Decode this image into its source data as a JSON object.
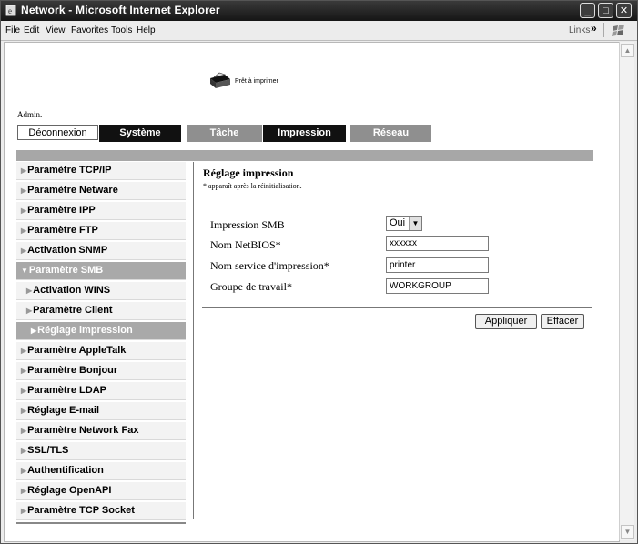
{
  "window": {
    "title": "Network - Microsoft Internet Explorer"
  },
  "menu": {
    "items": [
      "File",
      "Edit",
      "View",
      "Favorites",
      "Tools",
      "Help"
    ],
    "links_label": "Links",
    "chevron": "»"
  },
  "header": {
    "status_text": "Prêt à imprimer",
    "user_label": "Admin."
  },
  "top_nav": {
    "logout_label": "Déconnexion",
    "tabs": [
      "Système",
      "Tâche",
      "Impression",
      "Réseau"
    ],
    "active_tab": "Réseau"
  },
  "sidebar": {
    "items": [
      "Paramètre TCP/IP",
      "Paramètre Netware",
      "Paramètre IPP",
      "Paramètre FTP",
      "Activation SNMP",
      "Paramètre SMB",
      "Activation WINS",
      "Paramètre Client",
      "Réglage impression",
      "Paramètre AppleTalk",
      "Paramètre Bonjour",
      "Paramètre LDAP",
      "Réglage E-mail",
      "Paramètre Network Fax",
      "SSL/TLS",
      "Authentification",
      "Réglage OpenAPI",
      "Paramètre TCP Socket"
    ],
    "expanded": "Paramètre SMB",
    "selected": "Réglage impression"
  },
  "main": {
    "title": "Réglage impression",
    "note": "* apparaît après la réinitialisation.",
    "fields": {
      "smb_print": {
        "label": "Impression SMB",
        "value": "Oui"
      },
      "netbios_name": {
        "label": "Nom NetBIOS*",
        "value": "xxxxxx"
      },
      "print_service_name": {
        "label": "Nom service d'impression*",
        "value": "printer"
      },
      "workgroup": {
        "label": "Groupe de travail*",
        "value": "WORKGROUP"
      }
    },
    "apply_label": "Appliquer",
    "clear_label": "Effacer"
  },
  "colors": {
    "titlebar": "#1e1e1e",
    "tab_dark": "#111111",
    "tab_grey": "#8f8f8f",
    "band": "#a7a7a7",
    "selected_nav": "#a9a9a9"
  },
  "icons": [
    "ie-icon",
    "printer-icon",
    "windows-flag-icon",
    "minimize-icon",
    "maximize-icon",
    "close-icon",
    "dropdown-arrow-icon",
    "scroll-up-icon",
    "scroll-down-icon"
  ]
}
